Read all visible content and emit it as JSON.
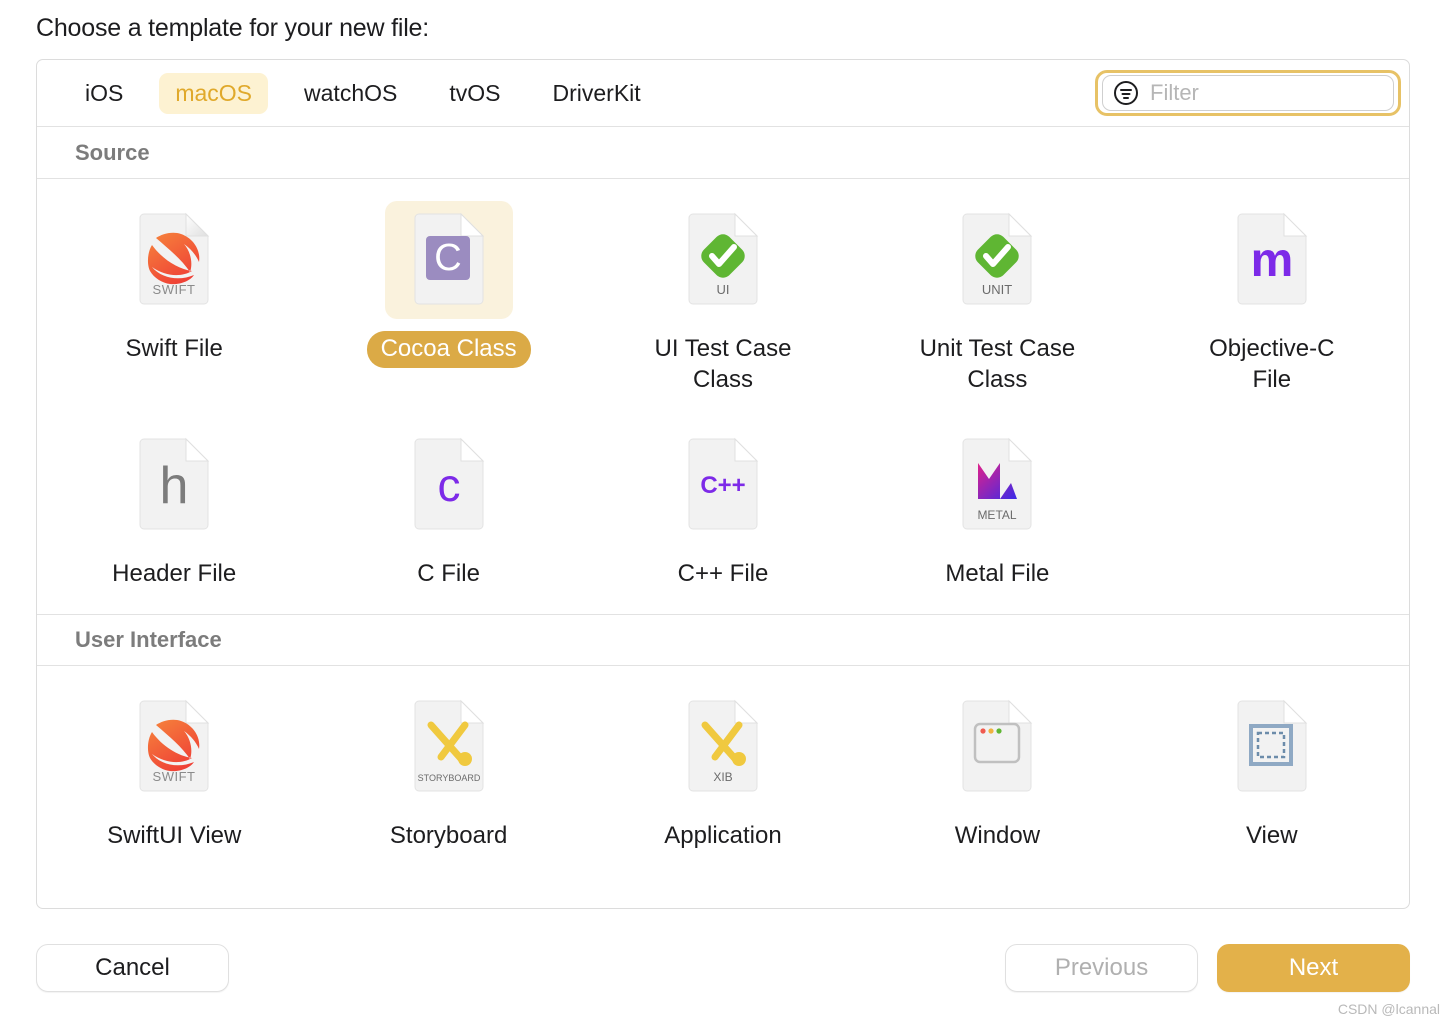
{
  "prompt": "Choose a template for your new file:",
  "tabs": [
    {
      "label": "iOS",
      "active": false
    },
    {
      "label": "macOS",
      "active": true
    },
    {
      "label": "watchOS",
      "active": false
    },
    {
      "label": "tvOS",
      "active": false
    },
    {
      "label": "DriverKit",
      "active": false
    }
  ],
  "filter": {
    "value": "",
    "placeholder": "Filter",
    "icon": "filter-icon",
    "focused": true
  },
  "sections": [
    {
      "title": "Source",
      "items": [
        {
          "label": "Swift File",
          "icon": "swift-file-icon",
          "badge": "SWIFT",
          "selected": false
        },
        {
          "label": "Cocoa Class",
          "icon": "cocoa-class-icon",
          "badge": "C",
          "selected": true
        },
        {
          "label": "UI Test Case Class",
          "icon": "ui-test-case-icon",
          "badge": "UI",
          "selected": false
        },
        {
          "label": "Unit Test Case Class",
          "icon": "unit-test-case-icon",
          "badge": "UNIT",
          "selected": false
        },
        {
          "label": "Objective-C File",
          "icon": "objective-c-file-icon",
          "badge": "m",
          "selected": false
        },
        {
          "label": "Header File",
          "icon": "header-file-icon",
          "badge": "h",
          "selected": false
        },
        {
          "label": "C File",
          "icon": "c-file-icon",
          "badge": "c",
          "selected": false
        },
        {
          "label": "C++ File",
          "icon": "cpp-file-icon",
          "badge": "C++",
          "selected": false
        },
        {
          "label": "Metal File",
          "icon": "metal-file-icon",
          "badge": "METAL",
          "selected": false
        }
      ]
    },
    {
      "title": "User Interface",
      "items": [
        {
          "label": "SwiftUI View",
          "icon": "swiftui-view-icon",
          "badge": "SWIFT",
          "selected": false
        },
        {
          "label": "Storyboard",
          "icon": "storyboard-icon",
          "badge": "STORYBOARD",
          "selected": false
        },
        {
          "label": "Application",
          "icon": "application-xib-icon",
          "badge": "XIB",
          "selected": false
        },
        {
          "label": "Window",
          "icon": "window-icon",
          "badge": "",
          "selected": false
        },
        {
          "label": "View",
          "icon": "view-icon",
          "badge": "",
          "selected": false
        }
      ]
    }
  ],
  "footer": {
    "cancel": "Cancel",
    "previous": "Previous",
    "next": "Next",
    "previous_disabled": true
  },
  "watermark": "CSDN @lcannal",
  "colors": {
    "accent": "#e3b14a",
    "tab_active_bg": "#fdf2d2",
    "tab_active_text": "#e0a92b",
    "selected_caption_bg": "#dbaa46",
    "selected_thumb_bg": "#faf2dd",
    "swift_orange": "#f05138",
    "cocoa_purple": "#9b8cc0",
    "test_green": "#5fb633",
    "objc_purple": "#7d2ae8",
    "metal_gradient_from": "#e0218a",
    "metal_gradient_to": "#3b2ae8",
    "storyboard_yellow": "#f0c93f",
    "view_blue": "#8fa9c4"
  }
}
